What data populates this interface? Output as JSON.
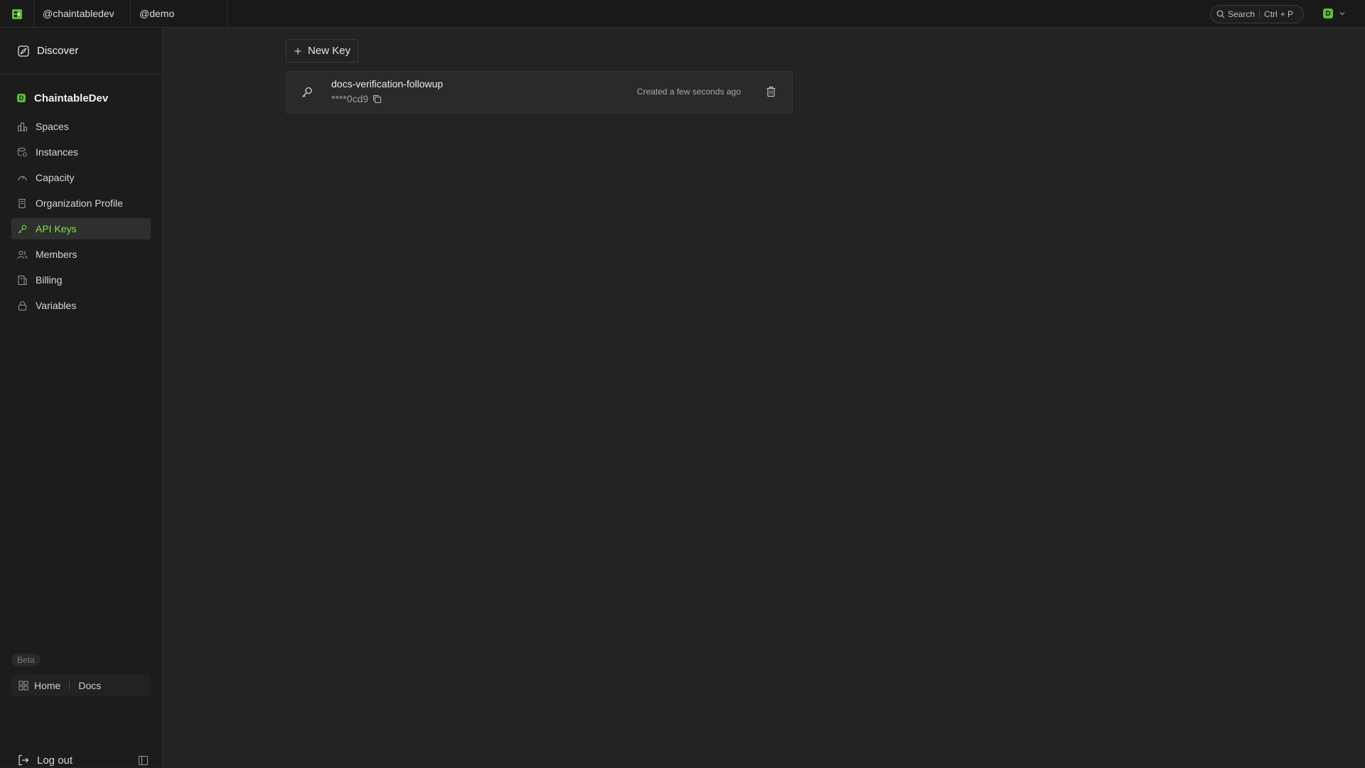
{
  "topbar": {
    "tabs": [
      {
        "label": "@chaintabledev"
      },
      {
        "label": "@demo"
      }
    ],
    "search": {
      "label": "Search",
      "shortcut_mod": "Ctrl",
      "shortcut_key": "+ P"
    },
    "user": {
      "avatar_letter": "D"
    }
  },
  "sidebar": {
    "discover": "Discover",
    "org_name": "ChaintableDev",
    "items": [
      {
        "label": "Spaces",
        "icon": "spaces-icon"
      },
      {
        "label": "Instances",
        "icon": "instances-icon"
      },
      {
        "label": "Capacity",
        "icon": "capacity-icon"
      },
      {
        "label": "Organization Profile",
        "icon": "organization-icon"
      },
      {
        "label": "API Keys",
        "icon": "key-icon",
        "active": true
      },
      {
        "label": "Members",
        "icon": "members-icon"
      },
      {
        "label": "Billing",
        "icon": "billing-icon"
      },
      {
        "label": "Variables",
        "icon": "lock-icon"
      }
    ],
    "beta": "Beta",
    "home": "Home",
    "docs": "Docs",
    "logout": "Log out"
  },
  "main": {
    "new_key_label": "New Key",
    "keys": [
      {
        "name": "docs-verification-followup",
        "masked": "****0cd9",
        "created": "Created a few seconds ago"
      }
    ]
  },
  "colors": {
    "accent": "#7fe340",
    "background": "#232323",
    "sidebar": "#1c1c1c"
  }
}
